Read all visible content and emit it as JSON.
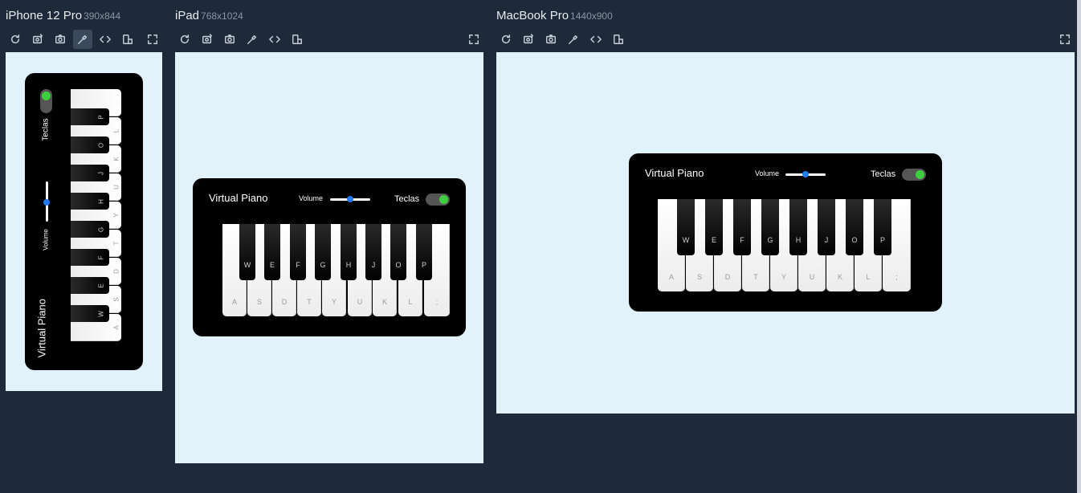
{
  "toolbar_icons": [
    "refresh-icon",
    "camera-rotate-icon",
    "camera-icon",
    "eyedropper-icon",
    "code-icon",
    "device-rotate-icon",
    "fullscreen-icon"
  ],
  "devices": [
    {
      "name": "iPhone 12 Pro",
      "dims": "390x844"
    },
    {
      "name": "iPad",
      "dims": "768x1024"
    },
    {
      "name": "MacBook Pro",
      "dims": "1440x900"
    }
  ],
  "piano": {
    "title": "Virtual Piano",
    "volume_label": "Volume",
    "keys_toggle_label": "Teclas",
    "keys_toggle_on": true,
    "volume_level": 0.55,
    "white_keys": [
      "A",
      "S",
      "D",
      "T",
      "Y",
      "U",
      "K",
      "L",
      ";"
    ],
    "black_keys": [
      "W",
      "E",
      "F",
      "G",
      "H",
      "J",
      "O",
      "P"
    ]
  },
  "colors": {
    "accent": "#1e7bff",
    "toggle_on": "#3cd13c",
    "frame_bg": "#e1f2fb",
    "page_bg": "#1e2a3a"
  }
}
